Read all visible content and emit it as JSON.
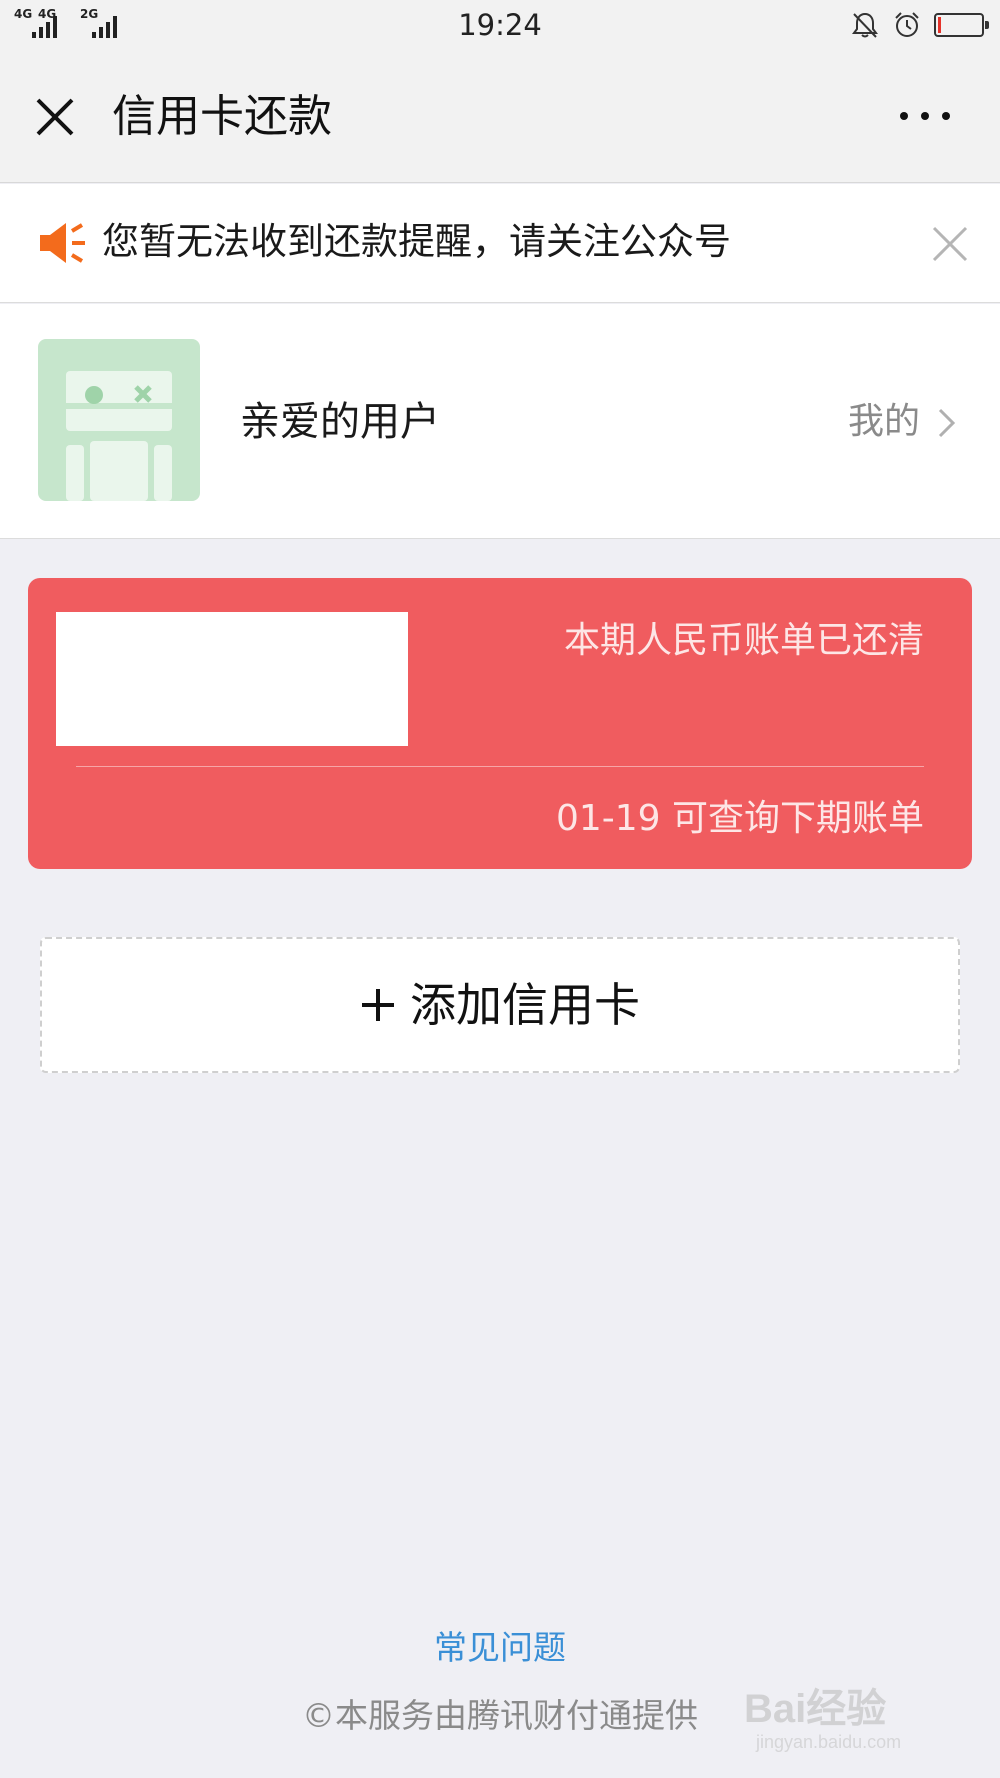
{
  "status_bar": {
    "network1": "4G",
    "network2": "4G",
    "network3": "2G",
    "time": "19:24",
    "battery_level": 0.08
  },
  "nav": {
    "title": "信用卡还款"
  },
  "notice": {
    "text": "您暂无法收到还款提醒，请关注公众号"
  },
  "user": {
    "name": "亲爱的用户",
    "mine_label": "我的"
  },
  "card": {
    "status": "本期人民币账单已还清",
    "next_bill": "01-19 可查询下期账单"
  },
  "add_card": {
    "label": "添加信用卡"
  },
  "footer": {
    "faq": "常见问题",
    "provider": "©本服务由腾讯财付通提供"
  },
  "watermark": {
    "brand": "Bai经验",
    "url": "jingyan.baidu.com"
  },
  "colors": {
    "card_bg": "#f05c5f",
    "link": "#3a8fd6",
    "speaker": "#f36b1c"
  }
}
